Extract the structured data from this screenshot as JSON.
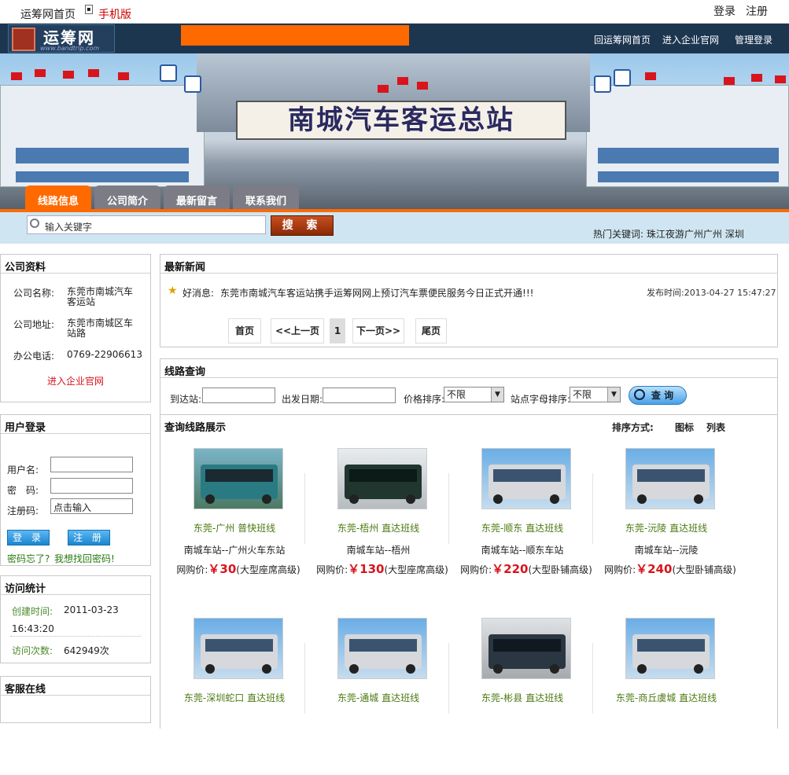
{
  "topbar": {
    "home": "运筹网首页",
    "mobile": "手机版",
    "login": "登录",
    "register": "注册"
  },
  "brand": {
    "name": "运筹网",
    "url": "www.bandtrip.com"
  },
  "header_links": [
    "回运筹网首页",
    "进入企业官网",
    "管理登录"
  ],
  "banner": {
    "sign": "南城汽车客运总站"
  },
  "tabs": [
    "线路信息",
    "公司简介",
    "最新留言",
    "联系我们"
  ],
  "search": {
    "placeholder": "输入关键字",
    "button": "搜 索",
    "hot_label": "热门关键词:",
    "hot_keywords": "珠江夜游广州广州 深圳"
  },
  "company": {
    "title": "公司资料",
    "name_label": "公司名称:",
    "name_line1": "东莞市南城汽车",
    "name_line2": "客运站",
    "addr_label": "公司地址:",
    "addr_line1": "东莞市南城区车",
    "addr_line2": "站路",
    "phone_label": "办公电话:",
    "phone": "0769-22906613",
    "link": "进入企业官网"
  },
  "login": {
    "title": "用户登录",
    "user_label": "用户名:",
    "pwd_label": "密　码:",
    "code_label": "注册码:",
    "code_value": "点击输入",
    "login_btn": "登 录",
    "register_btn": "注 册",
    "forgot": "密码忘了?",
    "recover": "我想找回密码!"
  },
  "stats": {
    "title": "访问统计",
    "created_label": "创建时间:",
    "created_date": "2011-03-23",
    "created_time": "16:43:20",
    "visits_label": "访问次数:",
    "visits": "642949次"
  },
  "service": {
    "title": "客服在线"
  },
  "news": {
    "title": "最新新闻",
    "prefix": "好消息:",
    "item": "东莞市南城汽车客运站携手运筹网网上预订汽车票便民服务今日正式开通!!!",
    "time": "发布时间:2013-04-27 15:47:27",
    "pager": {
      "first": "首页",
      "prev": "<<上一页",
      "current": "1",
      "next": "下一页>>",
      "last": "尾页"
    }
  },
  "route_query": {
    "title": "线路查询",
    "dest_label": "到达站:",
    "date_label": "出发日期:",
    "price_label": "价格排序:",
    "price_value": "不限",
    "letter_label": "站点字母排序:",
    "letter_value": "不限",
    "button": "查 询"
  },
  "display": {
    "title": "查询线路展示",
    "sort_label": "排序方式:",
    "icon_view": "图标",
    "list_view": "列表"
  },
  "routes": [
    {
      "name": "东莞-广州  普快班线",
      "route": "南城车站--广州火车东站",
      "price_label": "网购价:",
      "price": "￥30",
      "note": "(大型座席高级)"
    },
    {
      "name": "东莞-梧州  直达班线",
      "route": "南城车站--梧州",
      "price_label": "网购价:",
      "price": "￥130",
      "note": "(大型座席高级)"
    },
    {
      "name": "东莞-顺东  直达班线",
      "route": "南城车站--顺东车站",
      "price_label": "网购价:",
      "price": "￥220",
      "note": "(大型卧铺高级)"
    },
    {
      "name": "东莞-沅陵  直达班线",
      "route": "南城车站--沅陵",
      "price_label": "网购价:",
      "price": "￥240",
      "note": "(大型卧铺高级)"
    },
    {
      "name": "东莞-深圳蛇口  直达班线"
    },
    {
      "name": "东莞-通城  直达班线"
    },
    {
      "name": "东莞-彬县  直达班线"
    },
    {
      "name": "东莞-商丘虞城  直达班线"
    }
  ]
}
